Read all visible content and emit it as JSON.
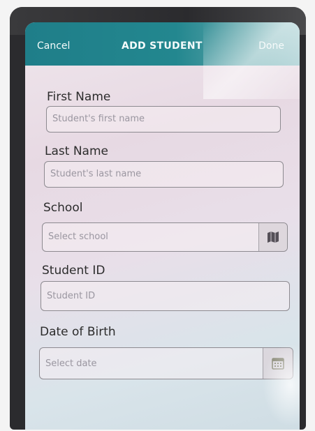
{
  "nav": {
    "cancel_label": "Cancel",
    "title": "ADD STUDENT",
    "done_label": "Done"
  },
  "form": {
    "first_name": {
      "label": "First Name",
      "placeholder": "Student's first name"
    },
    "last_name": {
      "label": "Last Name",
      "placeholder": "Student's last name"
    },
    "school": {
      "label": "School",
      "placeholder": "Select school",
      "icon": "map-icon"
    },
    "student_id": {
      "label": "Student ID",
      "placeholder": "Student ID"
    },
    "dob": {
      "label": "Date of Birth",
      "placeholder": "Select date",
      "icon": "calendar-icon"
    }
  },
  "colors": {
    "nav_bar": "#23878f",
    "nav_text": "#f4fbfb"
  }
}
